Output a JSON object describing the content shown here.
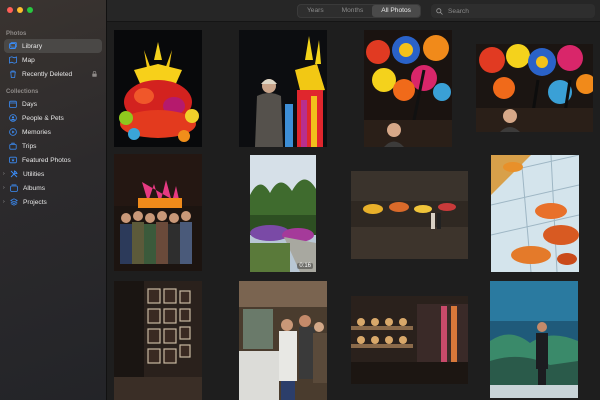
{
  "sidebar": {
    "photos_heading": "Photos",
    "photos_items": [
      {
        "label": "Library",
        "icon": "library-icon",
        "selected": true
      },
      {
        "label": "Map",
        "icon": "map-icon"
      },
      {
        "label": "Recently Deleted",
        "icon": "trash-icon",
        "locked": true
      }
    ],
    "collections_heading": "Collections",
    "collections_items": [
      {
        "label": "Days",
        "icon": "days-icon"
      },
      {
        "label": "People & Pets",
        "icon": "people-icon"
      },
      {
        "label": "Memories",
        "icon": "memories-icon"
      },
      {
        "label": "Trips",
        "icon": "trips-icon"
      },
      {
        "label": "Featured Photos",
        "icon": "featured-photos-icon"
      },
      {
        "label": "Utilities",
        "icon": "utilities-icon",
        "expandable": true
      },
      {
        "label": "Albums",
        "icon": "albums-icon",
        "expandable": true
      },
      {
        "label": "Projects",
        "icon": "projects-icon",
        "expandable": true
      }
    ]
  },
  "toolbar": {
    "view_options": [
      {
        "label": "Years",
        "active": false
      },
      {
        "label": "Months",
        "active": false
      },
      {
        "label": "All Photos",
        "active": true
      }
    ],
    "search_placeholder": "Search"
  },
  "photos": [
    {
      "name": "photo-chihuly-sculpture-red-yellow",
      "duration": ""
    },
    {
      "name": "photo-woman-with-glass-sculpture",
      "duration": ""
    },
    {
      "name": "photo-glass-ceiling-selfie",
      "duration": ""
    },
    {
      "name": "photo-glass-ceiling-colorful",
      "duration": ""
    },
    {
      "name": "photo-group-in-gallery",
      "duration": ""
    },
    {
      "name": "video-garden",
      "duration": "0:16"
    },
    {
      "name": "photo-gallery-room-wide",
      "duration": ""
    },
    {
      "name": "photo-glasshouse-chandelier",
      "duration": ""
    },
    {
      "name": "photo-framed-pictures-wall",
      "duration": ""
    },
    {
      "name": "photo-visitors-in-shop",
      "duration": ""
    },
    {
      "name": "photo-glass-collection-shelves",
      "duration": ""
    },
    {
      "name": "photo-aquarium-visitor",
      "duration": ""
    }
  ],
  "colors": {
    "sidebar_selected": "#4a4846",
    "close": "#ff5f57",
    "minimize": "#febc2e",
    "zoom": "#28c840",
    "accent_icon": "#3b8cf5"
  }
}
